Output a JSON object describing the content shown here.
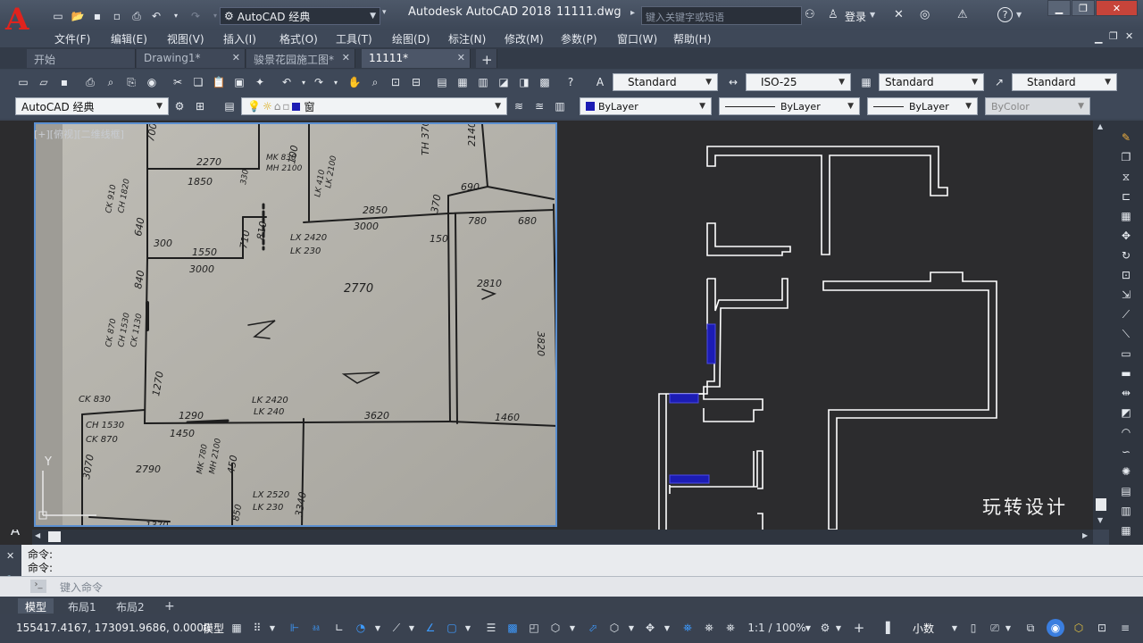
{
  "title_bar": {
    "workspace": "AutoCAD 经典",
    "app_title": "Autodesk AutoCAD 2018",
    "file_name": "11111.dwg",
    "search_placeholder": "键入关键字或短语",
    "login_label": "登录"
  },
  "menu": [
    "文件(F)",
    "编辑(E)",
    "视图(V)",
    "插入(I)",
    "格式(O)",
    "工具(T)",
    "绘图(D)",
    "标注(N)",
    "修改(M)",
    "参数(P)",
    "窗口(W)",
    "帮助(H)"
  ],
  "doc_tabs": [
    {
      "label": "开始"
    },
    {
      "label": "Drawing1*"
    },
    {
      "label": "骏景花园施工图*"
    },
    {
      "label": "11111*"
    }
  ],
  "styles_toolbar": {
    "text_style": "Standard",
    "dim_style": "ISO-25",
    "table_style": "Standard",
    "mleader_style": "Standard"
  },
  "toolbar2": {
    "workspace": "AutoCAD 经典",
    "layer": "窗",
    "color": "ByLayer",
    "linetype": "ByLayer",
    "lineweight": "ByLayer",
    "plotstyle": "ByColor"
  },
  "viewport": {
    "label": "[+][俯视][二维线框]",
    "axis_y": "Y"
  },
  "sketch_labels": [
    "700",
    "2270",
    "1850",
    "MK 830",
    "MH 2100",
    "100",
    "LK 410",
    "LK 2100",
    "TH 370",
    "2140",
    "690",
    "CK 910",
    "CH 1820",
    "2850",
    "370",
    "780",
    "680",
    "3000",
    "330",
    "810",
    "LX 2420",
    "LK 230",
    "150",
    "300",
    "1550",
    "710",
    "840",
    "3000",
    "2770",
    "2810",
    "3820",
    "CK 870",
    "CH 1530",
    "CK 1130",
    "1270",
    "CK 830",
    "LK 2420",
    "LK 240",
    "3620",
    "1460",
    "CH 1530",
    "CK 870",
    "1290",
    "1450",
    "MK 780",
    "MH 2100",
    "2790",
    "3070",
    "450",
    "LX 2520",
    "LK 230",
    "3340",
    "1370",
    "850",
    "640"
  ],
  "watermark": "玩转设计",
  "command_history": [
    "命令:",
    "命令:"
  ],
  "command_placeholder": "键入命令",
  "layout_tabs": [
    "模型",
    "布局1",
    "布局2"
  ],
  "status": {
    "coords": "155417.4167, 173091.9686, 0.0000",
    "model": "模型",
    "scale": "1:1 / 100%",
    "units": "小数"
  },
  "colors": {
    "canvas": "#2c2c2e",
    "ui_dark": "#3e4858",
    "wall_lines": "#ffffff",
    "window_fill": "#1c1cb4",
    "viewport_border": "#5b8fd0"
  }
}
